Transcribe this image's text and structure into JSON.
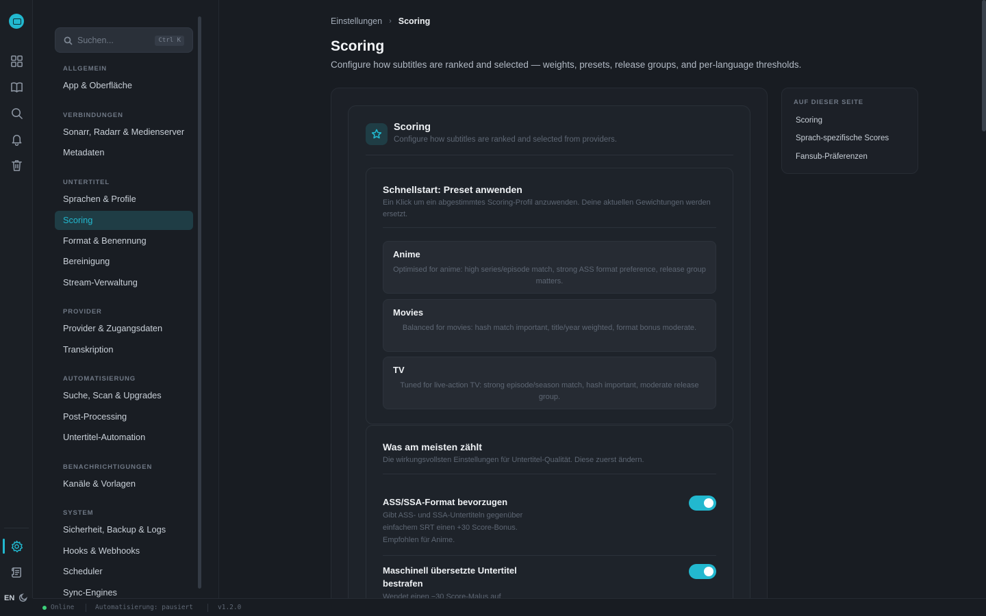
{
  "search": {
    "placeholder": "Suchen...",
    "shortcut": "Ctrl K"
  },
  "sidebar": {
    "groups": [
      {
        "label": "ALLGEMEIN",
        "items": [
          "App & Oberfläche"
        ]
      },
      {
        "label": "VERBINDUNGEN",
        "items": [
          "Sonarr, Radarr & Medienserver",
          "Metadaten"
        ]
      },
      {
        "label": "UNTERTITEL",
        "items": [
          "Sprachen & Profile",
          "Scoring",
          "Format & Benennung",
          "Bereinigung",
          "Stream-Verwaltung"
        ]
      },
      {
        "label": "PROVIDER",
        "items": [
          "Provider & Zugangsdaten",
          "Transkription"
        ]
      },
      {
        "label": "AUTOMATISIERUNG",
        "items": [
          "Suche, Scan & Upgrades",
          "Post-Processing",
          "Untertitel-Automation"
        ]
      },
      {
        "label": "BENACHRICHTIGUNGEN",
        "items": [
          "Kanäle & Vorlagen"
        ]
      },
      {
        "label": "SYSTEM",
        "items": [
          "Sicherheit, Backup & Logs",
          "Hooks & Webhooks",
          "Scheduler",
          "Sync-Engines"
        ]
      }
    ],
    "active_item": "Scoring"
  },
  "rail": {
    "language": "EN"
  },
  "breadcrumb": {
    "parent": "Einstellungen",
    "current": "Scoring"
  },
  "page": {
    "title": "Scoring",
    "description": "Configure how subtitles are ranked and selected — weights, presets, release groups, and per-language thresholds."
  },
  "card": {
    "title": "Scoring",
    "subtitle": "Configure how subtitles are ranked and selected from providers."
  },
  "quickstart": {
    "title": "Schnellstart: Preset anwenden",
    "description": "Ein Klick um ein abgestimmtes Scoring-Profil anzuwenden. Deine aktuellen Gewichtungen werden ersetzt.",
    "presets": [
      {
        "name": "Anime",
        "description": "Optimised for anime: high series/episode match, strong ASS format preference, release group matters."
      },
      {
        "name": "Movies",
        "description": "Balanced for movies: hash match important, title/year weighted, format bonus moderate."
      },
      {
        "name": "TV",
        "description": "Tuned for live-action TV: strong episode/season match, hash important, moderate release group."
      }
    ]
  },
  "important": {
    "title": "Was am meisten zählt",
    "description": "Die wirkungsvollsten Einstellungen für Untertitel-Qualität. Diese zuerst ändern.",
    "settings": [
      {
        "title": "ASS/SSA-Format bevorzugen",
        "description": "Gibt ASS- und SSA-Untertiteln gegenüber einfachem SRT einen +30 Score-Bonus. Empfohlen für Anime.",
        "enabled": true
      },
      {
        "title": "Maschinell übersetzte Untertitel bestrafen",
        "description": "Wendet einen −30 Score-Malus auf",
        "enabled": true
      }
    ]
  },
  "toc": {
    "title": "AUF DIESER SEITE",
    "links": [
      "Scoring",
      "Sprach-spezifische Scores",
      "Fansub-Präferenzen"
    ]
  },
  "status": {
    "connection": "Online",
    "automation": "Automatisierung: pausiert",
    "version": "v1.2.0"
  },
  "colors": {
    "accent": "#22b8cf",
    "online": "#3ccf7a",
    "background": "#181c22"
  }
}
